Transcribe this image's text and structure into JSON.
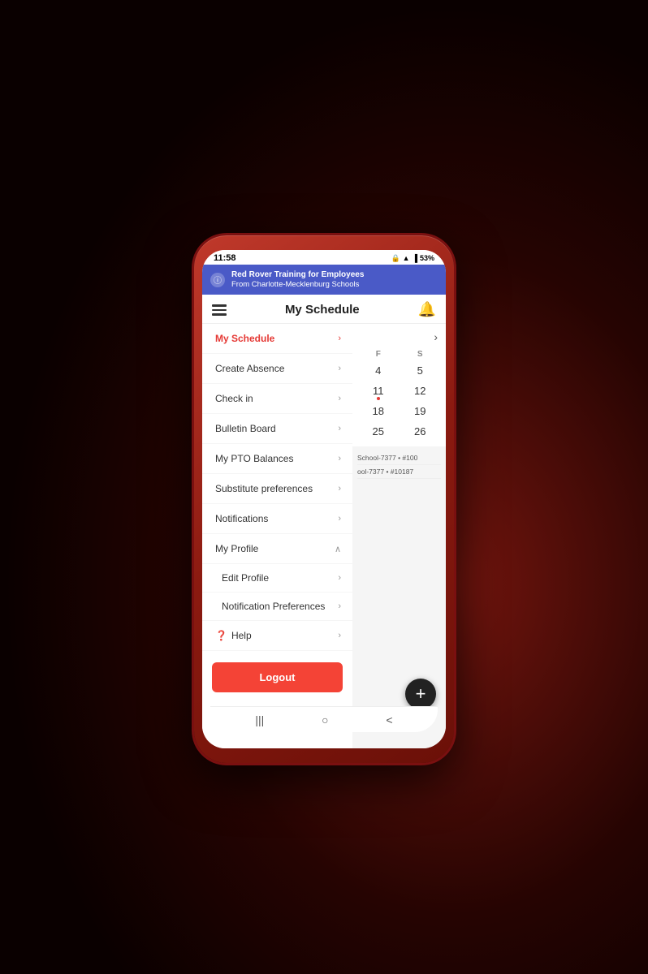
{
  "status_bar": {
    "time": "11:58",
    "battery": "53%",
    "icons": "🔔 📶 📶"
  },
  "notification_banner": {
    "title": "Red Rover Training for Employees",
    "subtitle": "From Charlotte-Mecklenburg Schools"
  },
  "header": {
    "title": "My Schedule",
    "bell_label": "🔔"
  },
  "menu": {
    "items": [
      {
        "label": "My Schedule",
        "active": true,
        "chevron": "›"
      },
      {
        "label": "Create Absence",
        "active": false,
        "chevron": "›"
      },
      {
        "label": "Check in",
        "active": false,
        "chevron": "›"
      },
      {
        "label": "Bulletin Board",
        "active": false,
        "chevron": "›"
      },
      {
        "label": "My PTO Balances",
        "active": false,
        "chevron": "›"
      },
      {
        "label": "Substitute preferences",
        "active": false,
        "chevron": "›"
      },
      {
        "label": "Notifications",
        "active": false,
        "chevron": "›"
      },
      {
        "label": "My Profile",
        "active": false,
        "chevron": "∧"
      }
    ],
    "subitems": [
      {
        "label": "Edit Profile",
        "chevron": "›"
      },
      {
        "label": "Notification Preferences",
        "chevron": "›"
      }
    ],
    "help_item": {
      "label": "Help",
      "chevron": "›"
    },
    "logout_label": "Logout"
  },
  "calendar": {
    "nav_arrow": "›",
    "day_headers": [
      "F",
      "S"
    ],
    "rows": [
      [
        "4",
        "5"
      ],
      [
        "11",
        "12"
      ],
      [
        "18",
        "19"
      ],
      [
        "25",
        "26"
      ]
    ],
    "dot_cells": [
      "11"
    ]
  },
  "schedule_items": [
    "School-7377 • #100",
    "ool-7377 • #10187"
  ],
  "fab": {
    "label": "+"
  },
  "bottom_nav": {
    "icons": [
      "|||",
      "○",
      "<"
    ]
  }
}
